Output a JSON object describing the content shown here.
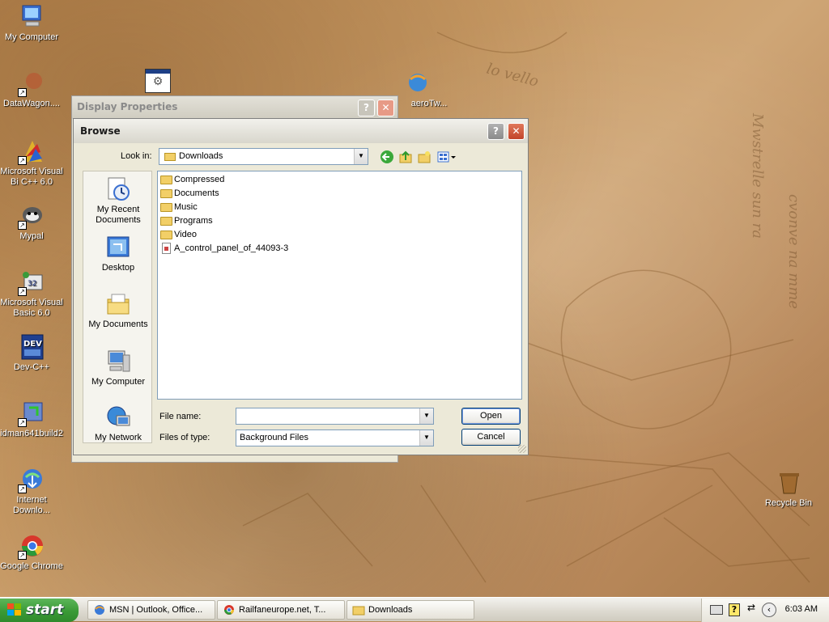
{
  "desktop_icons": [
    {
      "label": "My Computer",
      "icon": "my-computer-icon"
    },
    {
      "label": "DataWagon....",
      "icon": "datawagon-icon"
    },
    {
      "label": "Microsoft Visual Bi C++ 6.0",
      "icon": "visual-cpp-icon"
    },
    {
      "label": "Mypal",
      "icon": "mypal-icon"
    },
    {
      "label": "Microsoft Visual Basic 6.0",
      "icon": "visual-basic-icon"
    },
    {
      "label": "Dev-C++",
      "icon": "dev-cpp-icon"
    },
    {
      "label": "idman641build2",
      "icon": "idman-icon"
    },
    {
      "label": "Internet Downlo...",
      "icon": "internet-download-icon"
    },
    {
      "label": "Google Chrome",
      "icon": "chrome-icon"
    },
    {
      "label": "aeroTw...",
      "icon": "aerotw-icon"
    },
    {
      "label": "Recycle Bin",
      "icon": "recycle-bin-icon"
    }
  ],
  "display_properties": {
    "title": "Display Properties",
    "help": "?",
    "close": "✕"
  },
  "browse_dialog": {
    "title": "Browse",
    "help": "?",
    "close": "✕",
    "look_in_label": "Look in:",
    "look_in_value": "Downloads",
    "places": [
      {
        "label": "My Recent Documents",
        "icon": "recent-documents-icon"
      },
      {
        "label": "Desktop",
        "icon": "desktop-icon"
      },
      {
        "label": "My Documents",
        "icon": "my-documents-icon"
      },
      {
        "label": "My Computer",
        "icon": "my-computer-icon"
      },
      {
        "label": "My Network",
        "icon": "my-network-icon"
      }
    ],
    "files": [
      {
        "name": "Compressed",
        "type": "folder"
      },
      {
        "name": "Documents",
        "type": "folder"
      },
      {
        "name": "Music",
        "type": "folder"
      },
      {
        "name": "Programs",
        "type": "folder"
      },
      {
        "name": "Video",
        "type": "folder"
      },
      {
        "name": "A_control_panel_of_44093-3",
        "type": "file"
      }
    ],
    "file_name_label": "File name:",
    "file_name_value": "",
    "files_of_type_label": "Files of type:",
    "files_of_type_value": "Background Files",
    "open_label": "Open",
    "cancel_label": "Cancel"
  },
  "taskbar": {
    "start_label": "start",
    "buttons": [
      {
        "label": "MSN | Outlook, Office...",
        "icon": "ie-icon"
      },
      {
        "label": "Railfaneurope.net, T...",
        "icon": "chrome-icon"
      },
      {
        "label": "Downloads",
        "icon": "folder-icon"
      }
    ],
    "clock": "6:03 AM"
  }
}
